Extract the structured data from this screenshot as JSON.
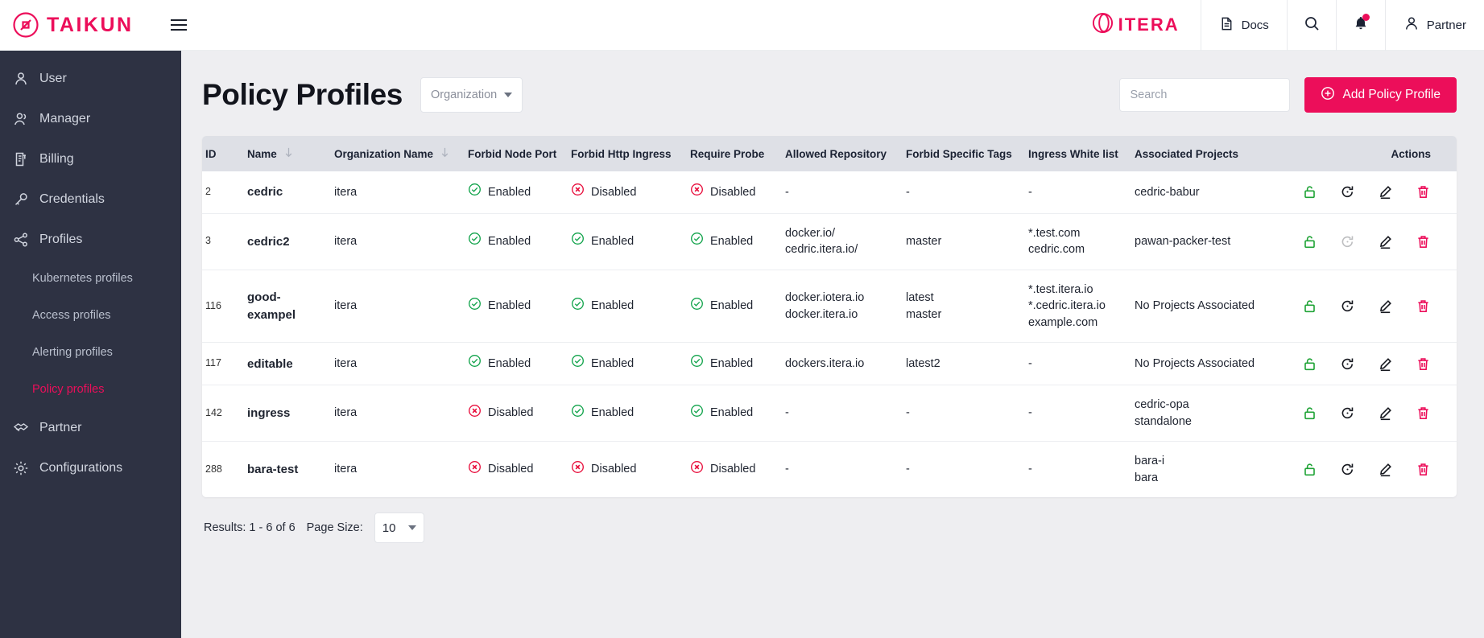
{
  "topbar": {
    "brand": "TAIKUN",
    "partner_logo": "ITERA",
    "docs_label": "Docs",
    "user_label": "Partner",
    "accent": "#ec0e5a"
  },
  "sidebar": {
    "items": [
      {
        "label": "User",
        "icon": "user-icon"
      },
      {
        "label": "Manager",
        "icon": "manager-icon"
      },
      {
        "label": "Billing",
        "icon": "billing-icon"
      },
      {
        "label": "Credentials",
        "icon": "key-icon"
      },
      {
        "label": "Profiles",
        "icon": "share-icon"
      }
    ],
    "sub_items": [
      {
        "label": "Kubernetes profiles",
        "active": false
      },
      {
        "label": "Access profiles",
        "active": false
      },
      {
        "label": "Alerting profiles",
        "active": false
      },
      {
        "label": "Policy profiles",
        "active": true
      }
    ],
    "bottom_items": [
      {
        "label": "Partner",
        "icon": "handshake-icon"
      },
      {
        "label": "Configurations",
        "icon": "gear-icon"
      }
    ]
  },
  "page": {
    "title": "Policy Profiles",
    "org_filter": "Organization",
    "search_placeholder": "Search",
    "search_value": "",
    "add_button": "Add Policy Profile"
  },
  "table": {
    "columns": [
      {
        "key": "id",
        "label": "ID",
        "sort": false
      },
      {
        "key": "name",
        "label": "Name",
        "sort": true
      },
      {
        "key": "org",
        "label": "Organization Name",
        "sort": true
      },
      {
        "key": "node_port",
        "label": "Forbid Node Port",
        "sort": false
      },
      {
        "key": "http_ingress",
        "label": "Forbid Http Ingress",
        "sort": false
      },
      {
        "key": "require_probe",
        "label": "Require Probe",
        "sort": false
      },
      {
        "key": "allowed_repo",
        "label": "Allowed Repository",
        "sort": false
      },
      {
        "key": "forbid_tags",
        "label": "Forbid Specific Tags",
        "sort": false
      },
      {
        "key": "ingress_white",
        "label": "Ingress White list",
        "sort": false
      },
      {
        "key": "projects",
        "label": "Associated Projects",
        "sort": false
      },
      {
        "key": "actions",
        "label": "Actions",
        "sort": false
      }
    ],
    "rows": [
      {
        "id": "2",
        "name": "cedric",
        "org": "itera",
        "node_port": "Enabled",
        "node_port_state": "on",
        "http_ingress": "Disabled",
        "http_ingress_state": "off",
        "require_probe": "Disabled",
        "require_probe_state": "off",
        "allowed_repo": "-",
        "forbid_tags": "-",
        "ingress_white": "-",
        "projects": "cedric-babur",
        "refresh_disabled": false
      },
      {
        "id": "3",
        "name": "cedric2",
        "org": "itera",
        "node_port": "Enabled",
        "node_port_state": "on",
        "http_ingress": "Enabled",
        "http_ingress_state": "on",
        "require_probe": "Enabled",
        "require_probe_state": "on",
        "allowed_repo": "docker.io/\ncedric.itera.io/",
        "forbid_tags": "master",
        "ingress_white": "*.test.com\ncedric.com",
        "projects": "pawan-packer-test",
        "refresh_disabled": true
      },
      {
        "id": "116",
        "name": "good-exampel",
        "org": "itera",
        "node_port": "Enabled",
        "node_port_state": "on",
        "http_ingress": "Enabled",
        "http_ingress_state": "on",
        "require_probe": "Enabled",
        "require_probe_state": "on",
        "allowed_repo": "docker.iotera.io\ndocker.itera.io",
        "forbid_tags": "latest\nmaster",
        "ingress_white": "*.test.itera.io\n*.cedric.itera.io\nexample.com",
        "projects": "No Projects Associated",
        "refresh_disabled": false
      },
      {
        "id": "117",
        "name": "editable",
        "org": "itera",
        "node_port": "Enabled",
        "node_port_state": "on",
        "http_ingress": "Enabled",
        "http_ingress_state": "on",
        "require_probe": "Enabled",
        "require_probe_state": "on",
        "allowed_repo": "dockers.itera.io",
        "forbid_tags": "latest2",
        "ingress_white": "-",
        "projects": "No Projects Associated",
        "refresh_disabled": false
      },
      {
        "id": "142",
        "name": "ingress",
        "org": "itera",
        "node_port": "Disabled",
        "node_port_state": "off",
        "http_ingress": "Enabled",
        "http_ingress_state": "on",
        "require_probe": "Enabled",
        "require_probe_state": "on",
        "allowed_repo": "-",
        "forbid_tags": "-",
        "ingress_white": "-",
        "projects": "cedric-opa\nstandalone",
        "refresh_disabled": false
      },
      {
        "id": "288",
        "name": "bara-test",
        "org": "itera",
        "node_port": "Disabled",
        "node_port_state": "off",
        "http_ingress": "Disabled",
        "http_ingress_state": "off",
        "require_probe": "Disabled",
        "require_probe_state": "off",
        "allowed_repo": "-",
        "forbid_tags": "-",
        "ingress_white": "-",
        "projects": "bara-i\nbara",
        "refresh_disabled": false
      }
    ],
    "actions": [
      "unlock-icon",
      "reset-icon",
      "edit-icon",
      "delete-icon"
    ]
  },
  "footer": {
    "results": "Results: 1 - 6 of 6",
    "page_size_label": "Page Size:",
    "page_size_value": "10"
  },
  "colors": {
    "enabled": "#14a44d",
    "disabled": "#e8123f",
    "accent": "#ec0e5a",
    "sidebar_bg": "#2e3243"
  }
}
